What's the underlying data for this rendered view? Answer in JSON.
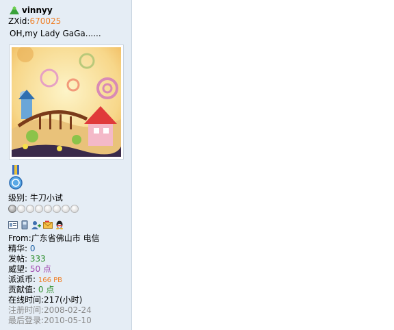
{
  "user": {
    "name": "vinnyy",
    "zxid_label": "ZXid:",
    "zxid_value": "670025",
    "signature": "OH,my Lady GaGa......"
  },
  "level": {
    "label": "级别:",
    "value": "牛刀小试"
  },
  "stars": {
    "filled": 1,
    "total": 8
  },
  "profile": {
    "from_label": "From:",
    "from_value": "广东省佛山市 电信",
    "jinghua_label": "精华:",
    "jinghua_value": "0",
    "fatie_label": "发帖:",
    "fatie_value": "333",
    "weiwang_label": "威望:",
    "weiwang_value": "50 点",
    "paipai_label": "派派币:",
    "paipai_value": "166 PB",
    "gongxian_label": "贡献值:",
    "gongxian_value": "0 点",
    "online": "在线时间:217(小时)",
    "reg": "注册时间:2008-02-24",
    "last": "最后登录:2010-05-10"
  },
  "icons": [
    "profile-card-icon",
    "phone-icon",
    "add-friend-icon",
    "message-icon",
    "qq-icon"
  ],
  "colors": {
    "panel_bg": "#e5edf5",
    "accent_orange": "#ef7d22",
    "link_blue": "#1f63a6"
  }
}
